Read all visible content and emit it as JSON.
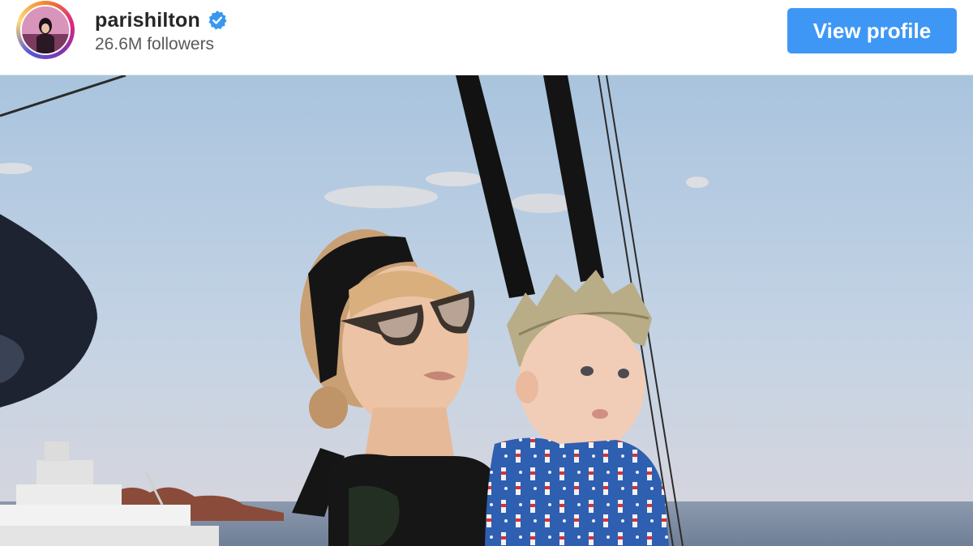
{
  "profile": {
    "username": "parishilton",
    "verified": true,
    "followers": "26.6M followers",
    "view_profile_label": "View profile"
  },
  "colors": {
    "button": "#3e97f5",
    "verified_badge": "#3897f0",
    "username": "#262626",
    "followers": "#595959"
  },
  "icons": {
    "verified": "verified-badge-icon",
    "avatar": "profile-avatar"
  }
}
